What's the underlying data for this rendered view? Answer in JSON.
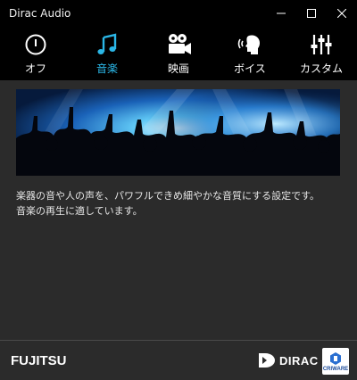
{
  "window": {
    "title": "Dirac Audio",
    "controls": [
      "minimize-icon",
      "maximize-icon",
      "close-icon"
    ]
  },
  "modes": [
    {
      "key": "off",
      "label": "オフ",
      "icon": "power-icon",
      "active": false
    },
    {
      "key": "music",
      "label": "音楽",
      "icon": "music-note-icon",
      "active": true
    },
    {
      "key": "movie",
      "label": "映画",
      "icon": "movie-camera-icon",
      "active": false
    },
    {
      "key": "voice",
      "label": "ボイス",
      "icon": "voice-head-icon",
      "active": false
    },
    {
      "key": "custom",
      "label": "カスタム",
      "icon": "equalizer-icon",
      "active": false
    }
  ],
  "content": {
    "banner_image": "concert-crowd-image",
    "description_line1": "楽器の音や人の声を、パワフルできめ細やかな音質にする設定です。",
    "description_line2": "音楽の再生に適しています。"
  },
  "footer": {
    "brand_left": "FUJITSU",
    "brand_dirac": "DIRAC",
    "brand_criware": "CRIWARE"
  },
  "colors": {
    "accent": "#2bb6e6",
    "titlebar_bg": "#000000",
    "content_bg": "#2b2b2b"
  }
}
